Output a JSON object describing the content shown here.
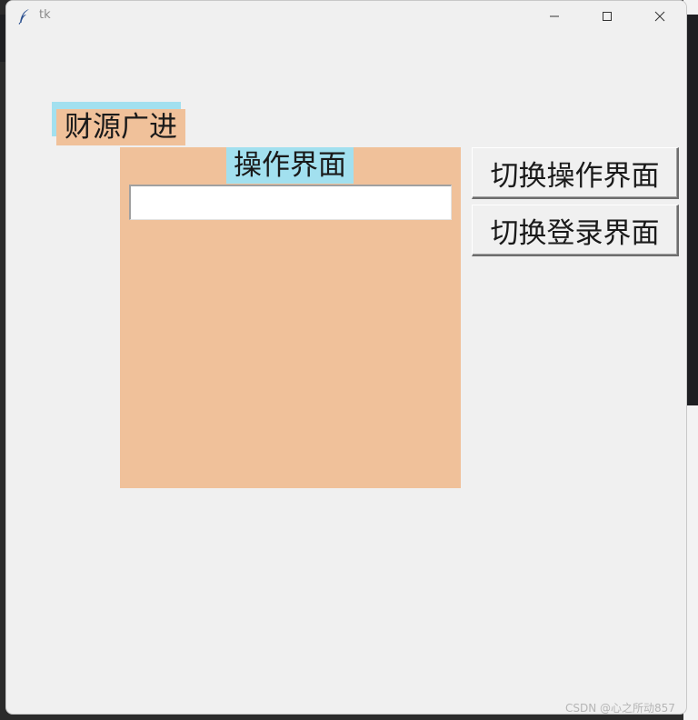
{
  "window": {
    "title": "tk"
  },
  "labels": {
    "hidden_label": "财源广进",
    "top_label": "财源广进"
  },
  "panel": {
    "title": "操作界面",
    "input_value": "",
    "input_placeholder": ""
  },
  "buttons": {
    "switch_operation": "切换操作界面",
    "switch_login": "切换登录界面"
  },
  "watermark": "CSDN @心之所动857",
  "colors": {
    "label_blue": "#a2e0ef",
    "label_orange": "#f0c19a",
    "window_bg": "#f0f0f0"
  },
  "icons": {
    "app": "feather-icon",
    "minimize": "minimize-icon",
    "maximize": "maximize-icon",
    "close": "close-icon"
  }
}
